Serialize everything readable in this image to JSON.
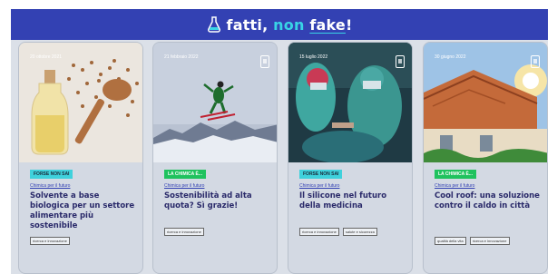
{
  "header": {
    "brand_left": "fatti",
    "brand_sep": ", ",
    "brand_mid": "non",
    "brand_space": " ",
    "brand_right": "fake",
    "brand_end": "!",
    "colors": {
      "bar": "#3341b3",
      "accent": "#38d4e6"
    },
    "icon": "flask-icon"
  },
  "cards": [
    {
      "date": "20 ottobre 2021",
      "badge": "FORSE NON SAI",
      "badge_color": "#3fd1dc",
      "category": "Chimica per il futuro",
      "title": "Solvente a base biologica per un settore alimentare più sostenibile",
      "tags": [
        "ricerca e innovazione"
      ]
    },
    {
      "date": "21 febbraio 2022",
      "badge": "LA CHIMICA È...",
      "badge_color": "#1fc25e",
      "category": "Chimica per il futuro",
      "title": "Sostenibilità ad alta quota? Sì grazie!",
      "tags": [
        "ricerca e innovazione"
      ]
    },
    {
      "date": "15 luglio 2022",
      "badge": "FORSE NON SAI",
      "badge_color": "#3fd1dc",
      "category": "Chimica per il futuro",
      "title": "Il silicone nel futuro della medicina",
      "tags": [
        "ricerca e innovazione",
        "salute e sicurezza"
      ]
    },
    {
      "date": "30 giugno 2022",
      "badge": "LA CHIMICA È...",
      "badge_color": "#1fc25e",
      "category": "Chimica per il futuro",
      "title": "Cool roof: una soluzione contro il caldo in città",
      "tags": [
        "qualità della vita",
        "ricerca e innovazione"
      ]
    }
  ]
}
